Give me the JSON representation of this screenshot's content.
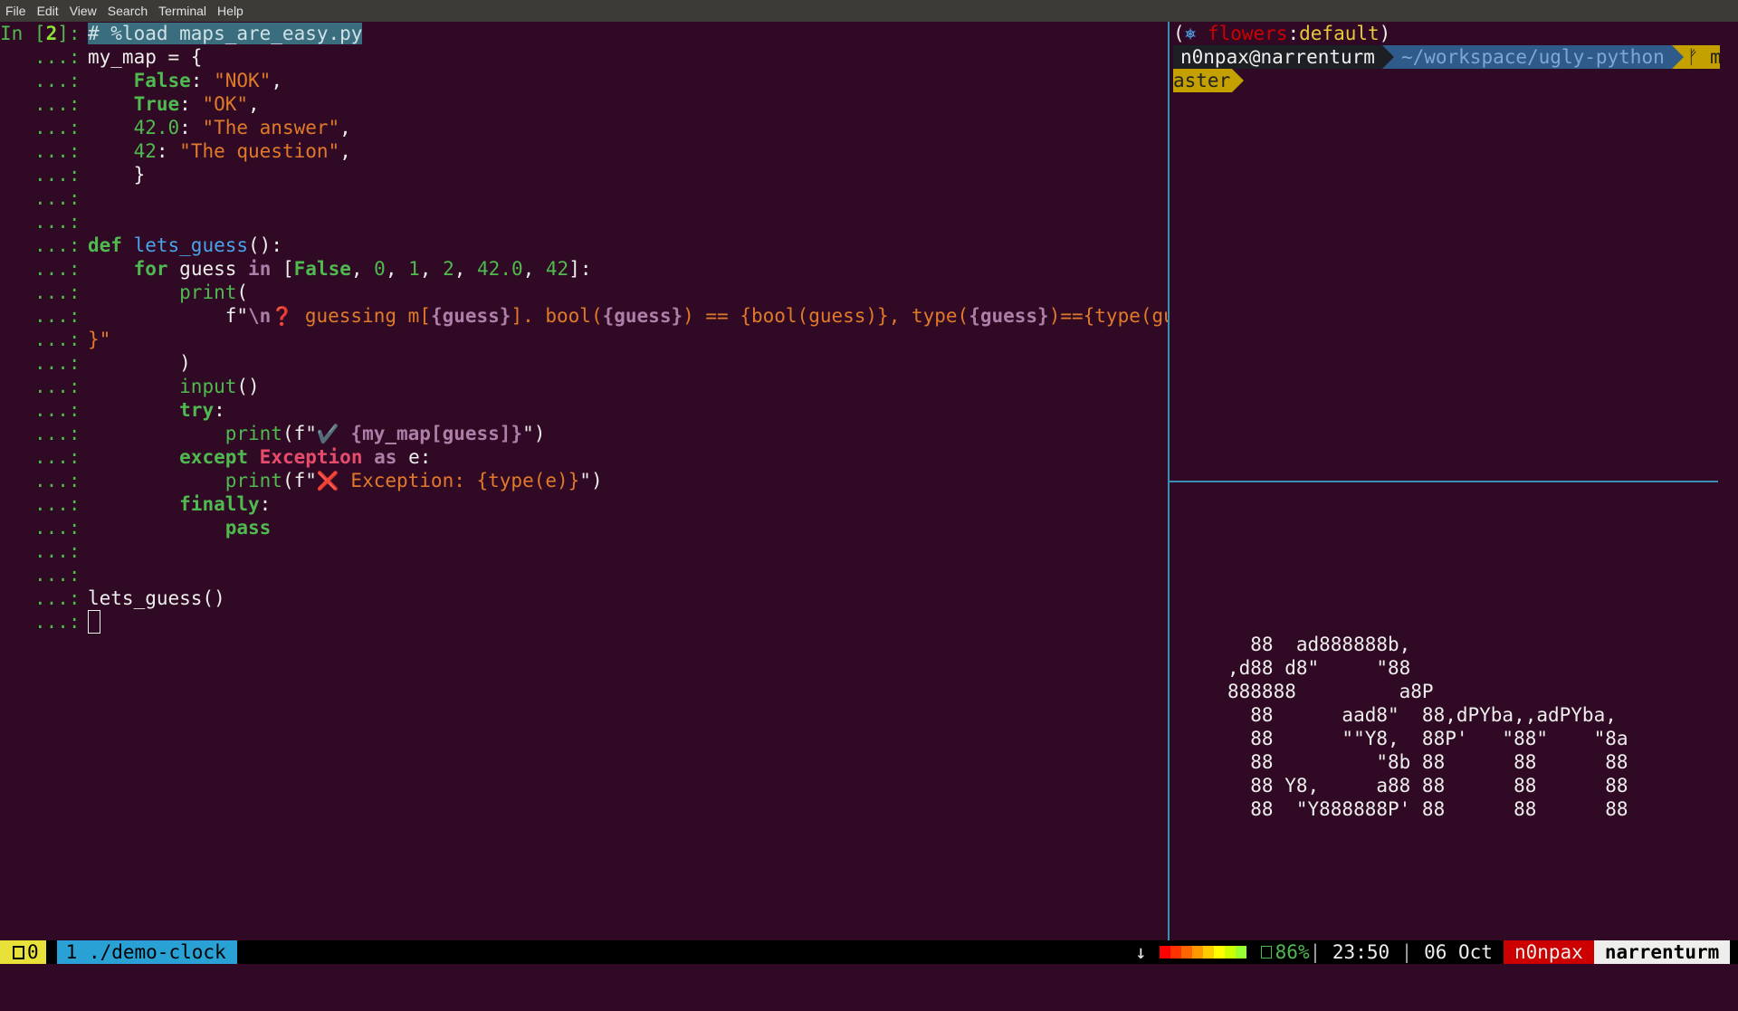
{
  "menu": [
    "File",
    "Edit",
    "View",
    "Search",
    "Terminal",
    "Help"
  ],
  "prompt": {
    "in": "In [",
    "num": "2",
    "close": "]:",
    "cont": "...:"
  },
  "code": {
    "l1": "# %load maps_are_easy.py",
    "l2a": "my_map = {",
    "false_kw": "False",
    "nok": "\"NOK\"",
    "true_kw": "True",
    "ok": "\"OK\"",
    "n420": "42.0",
    "answer": "\"The answer\"",
    "n42": "42",
    "question": "\"The question\"",
    "close_brace": "}",
    "def": "def",
    "fname": "lets_guess",
    "def_rest": "():",
    "for": "for",
    "guess": "guess",
    "in": "in",
    "list_open": "[",
    "list_end": "]:",
    "z": "0",
    "o": "1",
    "t": "2",
    "print": "print",
    "paren": "(",
    "fpfx": "f\"",
    "nl": "\\n",
    "qmark": "❓",
    "fs1": " guessing m[",
    "g1": "{guess}",
    "fs2": "]. bool(",
    "g2": "{guess}",
    "fs3": ") == {bool(guess)}, type(",
    "g3": "{guess}",
    "fs4": ")=={type(guess)",
    "wrap": "}\"",
    "close_paren": ")",
    "input": "input",
    "empty_call": "()",
    "try": "try",
    "colon": ":",
    "print_f": "print(f\"",
    "check": "✔️",
    "mapg": " {my_map[guess]}",
    "endq": "\")",
    "except": "except",
    "Exception": "Exception",
    "as": "as",
    "e_colon": " e:",
    "cross": "❌",
    "exc_txt": " Exception: {type(e)}",
    "finally": "finally",
    "pass": "pass",
    "call": "lets_guess()"
  },
  "right_top": {
    "kube_open": "(",
    "kube_icon": "⎈",
    "context": "flowers",
    "ns_sep": ":",
    "namespace": "default",
    "kube_close": ")",
    "user": "n0npax@narrenturm",
    "path": "~/workspace/ugly-python",
    "git_sym": "ᚠ m",
    "branch_cont": "aster"
  },
  "figlet": [
    "  88  ad888888b,",
    ",d88 d8\"     \"88",
    "888888         a8P",
    "  88      aad8\"  88,dPYba,,adPYba,",
    "  88      \"\"Y8,  88P'   \"88\"    \"8a",
    "  88         \"8b 88      88      88",
    "  88 Y8,     a88 88      88      88",
    "  88  \"Y888888P' 88      88      88"
  ],
  "status": {
    "session": "0",
    "window": "1 ./demo-clock",
    "arrow": "↓",
    "battery_pct": "86%",
    "battery_level": 0.86,
    "sep": "|",
    "time": "23:50",
    "date": "06 Oct",
    "user": "n0npax",
    "host": "narrenturm"
  },
  "colors": {
    "background": "#300a24",
    "green": "#4fba4f",
    "orange": "#e07a2a",
    "purple": "#ad7fa8",
    "divider": "#3a8fb7"
  }
}
